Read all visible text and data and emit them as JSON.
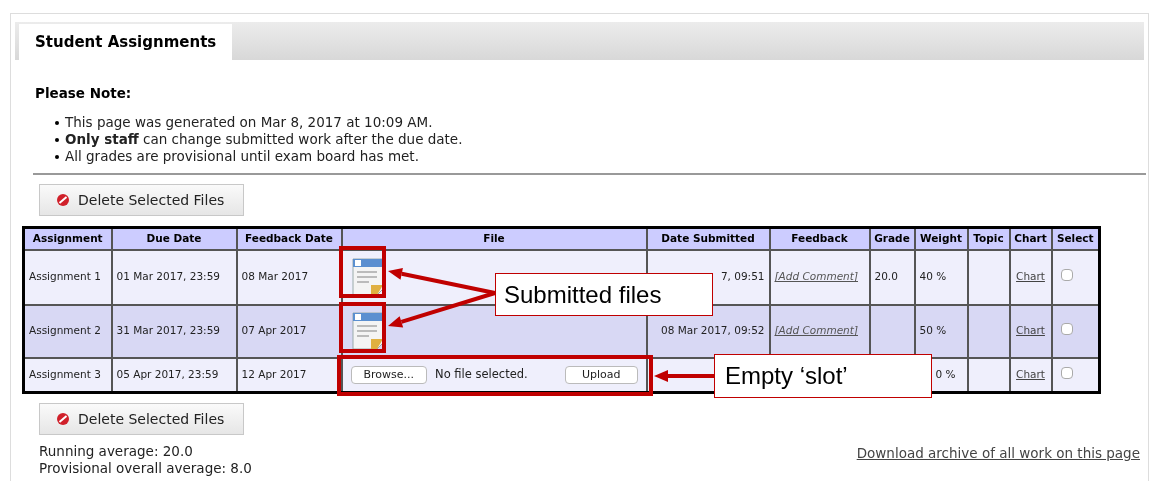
{
  "tab": {
    "label": "Student Assignments",
    "selected": true
  },
  "note": {
    "heading": "Please Note:",
    "items": [
      "This page was generated on Mar 8, 2017 at 10:09 AM.",
      "**Only staff** can change submitted work after the due date.",
      "All grades are provisional until exam board has met."
    ]
  },
  "delete_button_top": "Delete Selected Files",
  "table": {
    "columns": [
      "Assignment",
      "Due Date",
      "Feedback Date",
      "File",
      "Date Submitted",
      "Feedback",
      "Grade",
      "Weight",
      "Topic",
      "Chart",
      "Select"
    ],
    "rows": [
      {
        "assignment": "Assignment 1",
        "due_date": "01 Mar 2017, 23:59",
        "feedback_date": "08 Mar 2017",
        "file": {
          "kind": "submitted"
        },
        "date_submitted": "7, 09:51",
        "feedback": "[Add Comment]",
        "grade": "20.0",
        "weight": "40 %",
        "chart": "Chart",
        "checked": false
      },
      {
        "assignment": "Assignment 2",
        "due_date": "31 Mar 2017, 23:59",
        "feedback_date": "07 Apr 2017",
        "file": {
          "kind": "submitted"
        },
        "date_submitted": "08 Mar 2017, 09:52",
        "feedback": "[Add Comment]",
        "grade": "",
        "weight": "50 %",
        "chart": "Chart",
        "checked": false
      },
      {
        "assignment": "Assignment 3",
        "due_date": "05 Apr 2017, 23:59",
        "feedback_date": "12 Apr 2017",
        "file": {
          "kind": "upload",
          "browse": "Browse...",
          "status": "No file selected.",
          "upload": "Upload"
        },
        "weight": "0 %",
        "chart": "Chart",
        "checked": false
      }
    ]
  },
  "delete_button_bottom": "Delete Selected Files",
  "running_average": "Running average: 20.0",
  "overall_average": "Provisional overall average: 8.0",
  "download_link": "Download archive of all work on this page",
  "callouts": [
    "Submitted files",
    "Empty ‘slot’"
  ]
}
